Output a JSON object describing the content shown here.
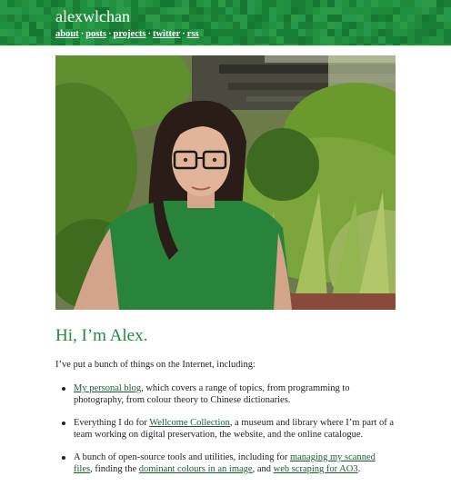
{
  "site": {
    "title": "alexwlchan",
    "accent": "#1e8a3a",
    "nav": [
      {
        "label": "about"
      },
      {
        "label": "posts"
      },
      {
        "label": "projects"
      },
      {
        "label": "twitter"
      },
      {
        "label": "rss"
      }
    ],
    "nav_separator": "·"
  },
  "hero_image": {
    "subject": "selfie-portrait"
  },
  "heading": "Hi, I’m Alex.",
  "intro": "I’ve put a bunch of things on the Internet, including:",
  "list": {
    "item1": {
      "link": "My personal blog",
      "text": ", which covers a range of topics, from programming to photography, from colour theory to Chinese dictionaries."
    },
    "item2": {
      "before": "Everything I do for ",
      "link": "Wellcome Collection",
      "text": ", a museum and library where I’m part of a team working on digital preservation, the website, and the online catalogue."
    },
    "item3": {
      "before": "A bunch of open-source tools and utilities, including for ",
      "link1": "managing my scanned files",
      "mid1": ", finding the ",
      "link2": "dominant colours in an image",
      "mid2": ", and ",
      "link3": "web scraping for AO3",
      "end": "."
    }
  }
}
